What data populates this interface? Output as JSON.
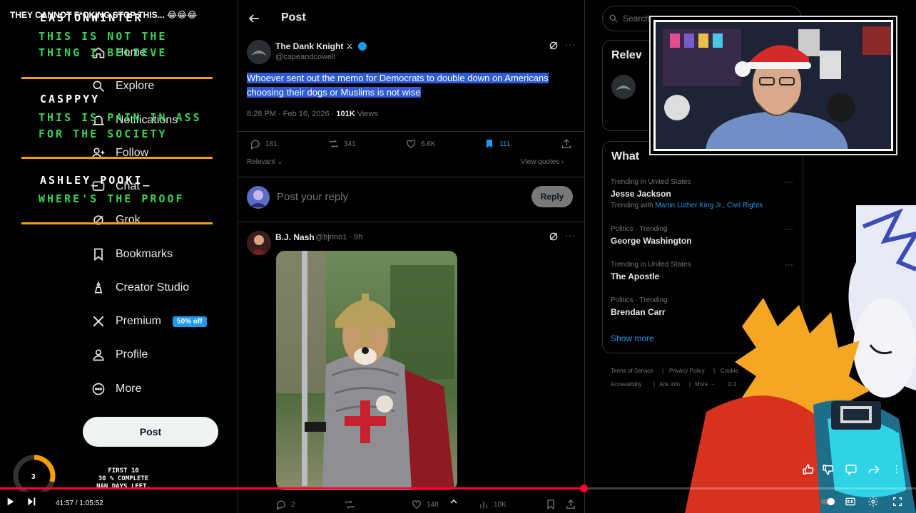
{
  "stream": {
    "title": "THEY CANNOT F*CKING STOP THIS... 😂😂😂",
    "chat": [
      {
        "user": "EASTONWINTER",
        "message": "THIS IS NOT THE THING I BELIEVE"
      },
      {
        "user": "CASPPYY",
        "message": "THIS IS PAIN IN ASS FOR THE SOCIETY"
      },
      {
        "user": "ASHLEY_POOKI_",
        "message": "WHERE'S THE PROOF"
      }
    ],
    "goal": {
      "count": "3",
      "label": "FIRST 10",
      "line2": "30 % COMPLETE",
      "line3": "NAN DAYS LEFT.",
      "percent": 30
    }
  },
  "nav": {
    "items": [
      {
        "label": "Home",
        "icon": "home-icon"
      },
      {
        "label": "Explore",
        "icon": "search-icon"
      },
      {
        "label": "Notifications",
        "icon": "bell-icon"
      },
      {
        "label": "Follow",
        "icon": "follow-icon"
      },
      {
        "label": "Chat",
        "icon": "chat-icon"
      },
      {
        "label": "Grok",
        "icon": "grok-icon"
      },
      {
        "label": "Bookmarks",
        "icon": "bookmark-icon"
      },
      {
        "label": "Creator Studio",
        "icon": "creator-studio-icon"
      },
      {
        "label": "Premium",
        "icon": "x-logo-icon",
        "badge": "50% off"
      },
      {
        "label": "Profile",
        "icon": "person-icon"
      },
      {
        "label": "More",
        "icon": "more-circle-icon"
      }
    ],
    "post_label": "Post"
  },
  "post_view": {
    "header_title": "Post",
    "tweet": {
      "author": "The Dank Knight ⚔",
      "handle": "@capeandcowell",
      "text": "Whoever sent out the memo for Democrats to double down on Americans choosing their dogs or Muslims is not wise",
      "time": "8:28 PM · Feb 16, 2026 · ",
      "views_count": "101K",
      "views_label": " Views",
      "replies": "181",
      "reposts": "341",
      "likes": "6.6K",
      "bookmarks": "111",
      "sort_label": "Relevant",
      "quotes_label": "View quotes ›"
    },
    "reply_placeholder": "Post your reply",
    "reply_button": "Reply",
    "reply": {
      "author": "B.J. Nash",
      "handle": "@bjnno1 · 9h",
      "replies": "2",
      "likes": "148",
      "views": "10K"
    }
  },
  "sidebar": {
    "search_placeholder": "Search",
    "relevant_title": "Relev",
    "whats_happening_title": "What",
    "trends": [
      {
        "meta": "Trending in United States",
        "name": "Jesse Jackson",
        "extra_prefix": "Trending with ",
        "extra": "Martin Luther King Jr., Civil Rights"
      },
      {
        "meta": "Politics · Trending",
        "name": "George Washington"
      },
      {
        "meta": "Trending in United States",
        "name": "The Apostle"
      },
      {
        "meta": "Politics · Trending",
        "name": "Brendan Carr"
      }
    ],
    "show_more": "Show more",
    "footer": [
      "Terms of Service",
      "|",
      "Privacy Policy",
      "|",
      "Cookie",
      "Accessibility",
      "|",
      "Ads info",
      "|",
      "More ···",
      "© 2"
    ]
  },
  "player": {
    "time": "41:57 / 1:05:52",
    "progress": 0.637
  },
  "colors": {
    "accent": "#1d9bf0",
    "progress": "#ff0033",
    "chat_green": "#39d353",
    "chat_bar": "#f59e0b",
    "highlight": "#2e5bd6"
  }
}
